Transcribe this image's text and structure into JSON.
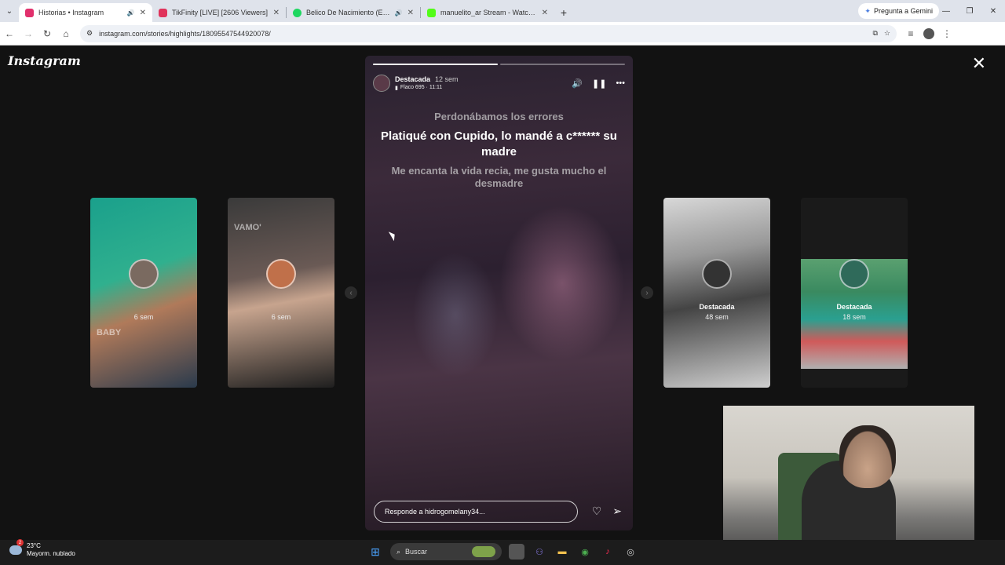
{
  "browser": {
    "tabs": [
      {
        "title": "Historias • Instagram",
        "active": true,
        "favicon_color": "#e1306c",
        "has_sound": true
      },
      {
        "title": "TikFinity [LIVE] [2606 Viewers]",
        "active": false,
        "favicon_color": "#e0335b",
        "has_sound": false
      },
      {
        "title": "Belico De Nacimiento (En V",
        "active": false,
        "favicon_color": "#1ed760",
        "has_sound": true
      },
      {
        "title": "manuelito_ar Stream - Watch L",
        "active": false,
        "favicon_color": "#53fc18",
        "has_sound": false
      }
    ],
    "gemini_label": "Pregunta a Gemini",
    "url": "instagram.com/stories/highlights/18095547544920078/"
  },
  "instagram": {
    "logo": "Instagram",
    "close_icon": "close-icon",
    "previews": [
      {
        "label": "",
        "time": "6 sem",
        "watermark": "BABY"
      },
      {
        "label": "",
        "time": "6 sem",
        "watermark": "VAMO'"
      },
      {
        "label": "Destacada",
        "time": "48 sem",
        "watermark": ""
      },
      {
        "label": "Destacada",
        "time": "18 sem",
        "watermark": ""
      }
    ],
    "story": {
      "progress_segments": 2,
      "progress_done": 1,
      "author": "Destacada",
      "age": "12 sem",
      "song": "Flaco 695 · 11:11",
      "lyrics_prev": "Perdonábamos los errores",
      "lyrics_current": "Platiqué con Cupido, lo mandé a c****** su madre",
      "lyrics_next": "Me encanta la vida recia, me gusta mucho el desmadre",
      "reply_placeholder": "Responde a hidrogomelany34..."
    }
  },
  "taskbar": {
    "weather_temp": "23°C",
    "weather_desc": "Mayorm. nublado",
    "notification_count": "2",
    "search_label": "Buscar"
  }
}
